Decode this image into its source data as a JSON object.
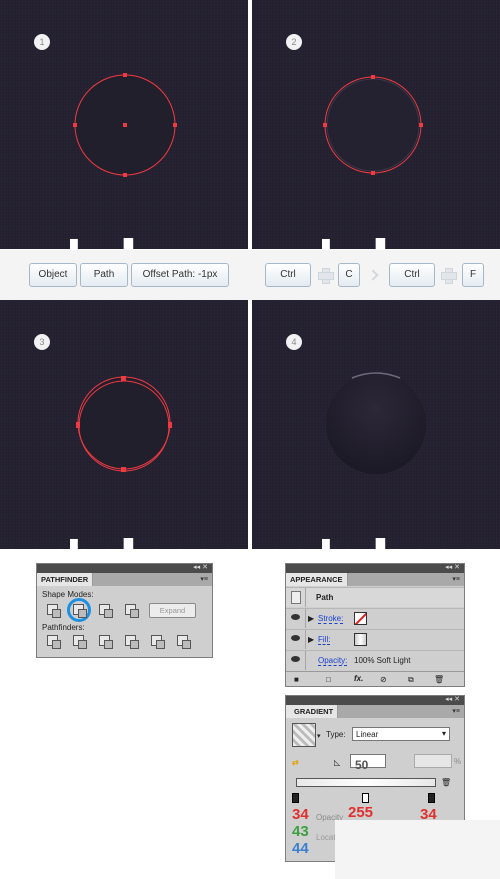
{
  "steps": [
    "1",
    "2",
    "3",
    "4"
  ],
  "toolbar_left": {
    "object": "Object",
    "path": "Path",
    "offset": "Offset Path: -1px"
  },
  "toolbar_right": {
    "ctrl1": "Ctrl",
    "c": "C",
    "ctrl2": "Ctrl",
    "f": "F"
  },
  "pathfinder": {
    "tab": "PATHFINDER",
    "shape_modes": "Shape Modes:",
    "pathfinders": "Pathfinders:",
    "expand": "Expand"
  },
  "appearance": {
    "tab": "APPEARANCE",
    "path": "Path",
    "stroke": "Stroke:",
    "fill": "Fill:",
    "opacity_label": "Opacity:",
    "opacity_value": "100% Soft Light",
    "fx": "fx."
  },
  "gradient": {
    "tab": "GRADIENT",
    "type_label": "Type:",
    "type_value": "Linear",
    "angle": "50",
    "pct_label": "%",
    "r_left": "34",
    "g_left": "43",
    "b_left": "44",
    "mid_value": "255",
    "r_right": "34",
    "opacity_label": "Opacity",
    "location_label": "Location"
  },
  "colors": {
    "canvas": "#232030",
    "selection": "#f03a42",
    "key_border": "#a6b7c8",
    "blue": "#1a3fd1"
  }
}
